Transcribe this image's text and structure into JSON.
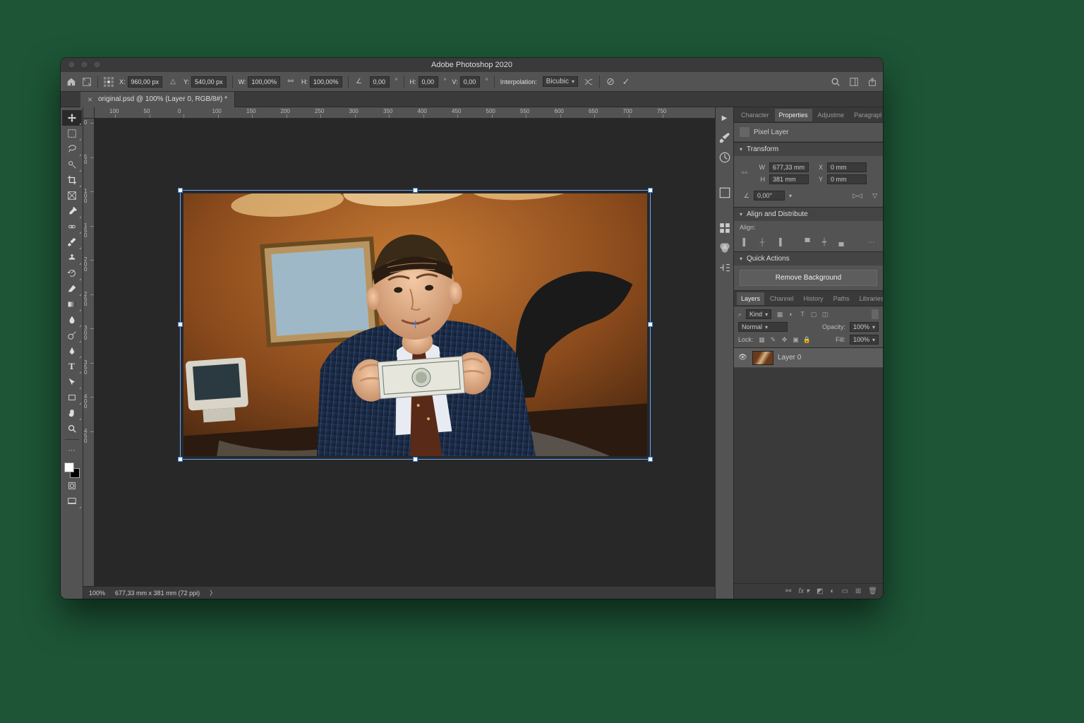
{
  "app_title": "Adobe Photoshop 2020",
  "tab": {
    "label": "original.psd @ 100% (Layer 0, RGB/8#) *"
  },
  "options_bar": {
    "x_label": "X:",
    "x_value": "960,00 px",
    "y_label": "Y:",
    "y_value": "540,00 px",
    "w_label": "W:",
    "w_value": "100,00%",
    "h_label": "H:",
    "h_value": "100,00%",
    "angle_value": "0,00",
    "skew_h_label": "H:",
    "skew_h_value": "0,00",
    "skew_v_label": "V:",
    "skew_v_value": "0,00",
    "interp_label": "Interpolation:",
    "interp_value": "Bicubic"
  },
  "ruler_h": [
    "100",
    "150",
    "200",
    "250",
    "300",
    "350",
    "400",
    "450",
    "500",
    "550",
    "600",
    "650",
    "700",
    "750"
  ],
  "ruler_h_neg": [
    "0",
    "50",
    "100"
  ],
  "ruler_v": [
    "0",
    "50",
    "100",
    "150",
    "200",
    "250",
    "300",
    "350",
    "400",
    "450"
  ],
  "status": {
    "zoom": "100%",
    "doc": "677,33 mm x 381 mm (72 ppi)"
  },
  "panels": {
    "top_tabs": [
      "Character",
      "Properties",
      "Adjustme",
      "Paragrapl"
    ],
    "top_active": 1,
    "pixel_layer_label": "Pixel Layer",
    "transform_label": "Transform",
    "transform": {
      "w_label": "W",
      "w_value": "677,33 mm",
      "x_label": "X",
      "x_value": "0 mm",
      "h_label": "H",
      "h_value": "381 mm",
      "y_label": "Y",
      "y_value": "0 mm",
      "angle_value": "0,00°"
    },
    "align_label": "Align and Distribute",
    "align_sub": "Align:",
    "quick_actions_label": "Quick Actions",
    "remove_bg": "Remove Background"
  },
  "layers_panel": {
    "tabs": [
      "Layers",
      "Channel",
      "History",
      "Paths",
      "Libraries"
    ],
    "active": 0,
    "kind_label": "Kind",
    "blend_mode": "Normal",
    "opacity_label": "Opacity:",
    "opacity_value": "100%",
    "lock_label": "Lock:",
    "fill_label": "Fill:",
    "fill_value": "100%",
    "layer_name": "Layer 0"
  }
}
